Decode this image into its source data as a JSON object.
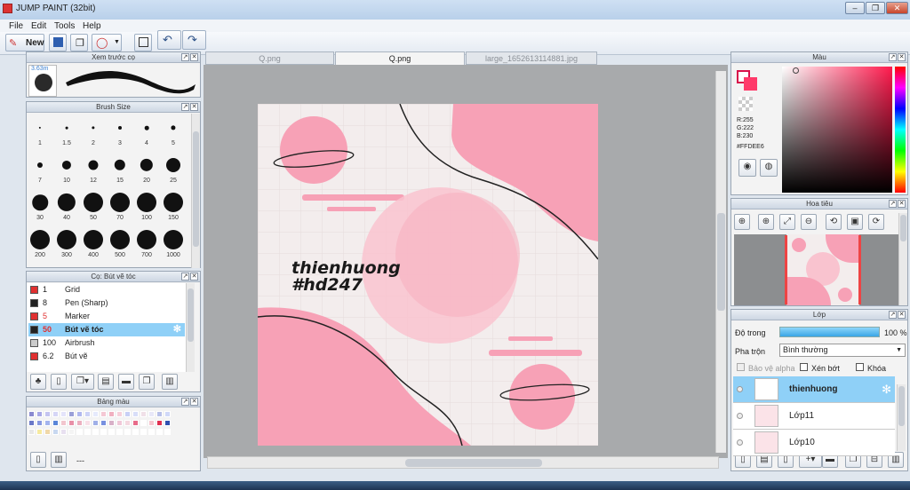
{
  "app": {
    "title": "JUMP PAINT (32bit)"
  },
  "menu": [
    "File",
    "Edit",
    "Tools",
    "Help"
  ],
  "toolbar": {
    "new_label": "New"
  },
  "tabs": [
    {
      "label": "Q.png",
      "active": false
    },
    {
      "label": "Q.png",
      "active": true
    },
    {
      "label": "large_1652613114881.jpg",
      "active": false
    }
  ],
  "preview_panel": {
    "title": "Xem trước cọ",
    "size_label": "3.63m"
  },
  "brush_size_panel": {
    "title": "Brush Size",
    "sizes": [
      "1",
      "1.5",
      "2",
      "3",
      "4",
      "5",
      "7",
      "10",
      "12",
      "15",
      "20",
      "25",
      "30",
      "40",
      "50",
      "70",
      "100",
      "150",
      "200",
      "300",
      "400",
      "500",
      "700",
      "1000"
    ]
  },
  "brush_list_panel": {
    "title": "Cọ: Bút vẽ tóc",
    "items": [
      {
        "size": "1",
        "name": "Grid",
        "color": "#e03030",
        "selected": false
      },
      {
        "size": "8",
        "name": "Pen (Sharp)",
        "color": "#222222",
        "selected": false
      },
      {
        "size": "5",
        "name": "Marker",
        "color": "#e03030",
        "selected": false
      },
      {
        "size": "50",
        "name": "Bút vẽ tóc",
        "color": "#222222",
        "selected": true
      },
      {
        "size": "100",
        "name": "Airbrush",
        "color": "#cccccc",
        "selected": false
      },
      {
        "size": "6.2",
        "name": "Bút vẽ",
        "color": "#e03030",
        "selected": false
      }
    ]
  },
  "palette_panel": {
    "title": "Bảng màu",
    "footer": "---",
    "colors": [
      "#8a8ad0",
      "#a8a8e6",
      "#c4c4f0",
      "#d6d6f6",
      "#e4e4fa",
      "#9aa0d8",
      "#b0b8ee",
      "#ccd2f6",
      "#e6eafc",
      "#f4c8d4",
      "#f0b0c0",
      "#f6d0da",
      "#c8d0f6",
      "#d8def8",
      "#f0e0e8",
      "#e8e8f8",
      "#b8c0e8",
      "#d0d8f8",
      "#6a78c8",
      "#8898e0",
      "#a4b4ee",
      "#5a86d8",
      "#f2c6ce",
      "#e890a8",
      "#ecb0c0",
      "#f8e0e8",
      "#a0b0e8",
      "#7890e0",
      "#d8b0c8",
      "#f0c8d8",
      "#f4d8e0",
      "#e86c8a",
      "#ffffff",
      "#f6c6d0",
      "#e03050",
      "#3050b0",
      "#e8e8e8",
      "#f6eaa0",
      "#f0d8a8",
      "#c8d8f0",
      "#e8e0f0",
      "#f4f4f4",
      "#ffffff",
      "#ffffff",
      "#ffffff",
      "#ffffff",
      "#ffffff",
      "#ffffff",
      "#ffffff",
      "#ffffff",
      "#ffffff",
      "#ffffff",
      "#ffffff",
      "#ffffff"
    ]
  },
  "color_panel": {
    "title": "Màu",
    "r": "R:255",
    "g": "G:222",
    "b": "B:230",
    "hex": "#FFDEE6",
    "fg_color": "#ff3a6a",
    "bg_color": "#ffffff"
  },
  "navigator_panel": {
    "title": "Hoa tiêu"
  },
  "layer_panel": {
    "title": "Lớp",
    "opacity_label": "Độ trong",
    "opacity_value": "100 %",
    "opacity": 1.0,
    "blend_label": "Pha trộn",
    "blend_value": "Bình thường",
    "alpha_label": "Bảo vệ alpha",
    "clip_label": "Xén bớt",
    "lock_label": "Khóa",
    "layers": [
      {
        "name": "thienhuong",
        "selected": true
      },
      {
        "name": "Lớp11",
        "selected": false
      },
      {
        "name": "Lớp10",
        "selected": false
      }
    ]
  },
  "artwork": {
    "line1": "thienhuong",
    "line2": "#hd247"
  },
  "colors": {
    "pink": "#f7a1b6",
    "pink_light": "#f9c3cf",
    "selection": "#8fd0f7"
  }
}
